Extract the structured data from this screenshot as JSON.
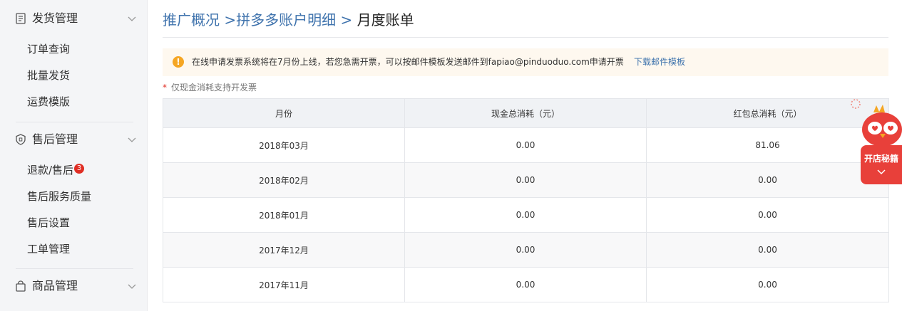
{
  "sidebar": {
    "sections": [
      {
        "title": "发货管理",
        "icon": "document-icon",
        "items": [
          "订单查询",
          "批量发货",
          "运费模版"
        ]
      },
      {
        "title": "售后管理",
        "icon": "shield-icon",
        "items": [
          "退款/售后",
          "售后服务质量",
          "售后设置",
          "工单管理"
        ],
        "badge": "3"
      },
      {
        "title": "商品管理",
        "icon": "bag-icon",
        "items": []
      }
    ]
  },
  "breadcrumb": {
    "link1": "推广概况",
    "sep1": " >",
    "link2": "拼多多账户明细",
    "sep2": " > ",
    "current": "月度账单"
  },
  "notice": {
    "icon": "!",
    "text": "在线申请发票系统将在7月份上线，若您急需开票，可以按邮件模板发送邮件到fapiao@pinduoduo.com申请开票",
    "link": "下载邮件模板"
  },
  "note": {
    "star": "*",
    "text": "仅现金消耗支持开发票"
  },
  "table": {
    "headers": [
      "月份",
      "现金总消耗（元）",
      "红包总消耗（元）"
    ],
    "rows": [
      [
        "2018年03月",
        "0.00",
        "81.06"
      ],
      [
        "2018年02月",
        "0.00",
        "0.00"
      ],
      [
        "2018年01月",
        "0.00",
        "0.00"
      ],
      [
        "2017年12月",
        "0.00",
        "0.00"
      ],
      [
        "2017年11月",
        "0.00",
        "0.00"
      ]
    ]
  },
  "widget": {
    "label": "开店秘籍"
  },
  "colors": {
    "link": "#3f73ad",
    "badge": "#e02e24",
    "warning": "#f5a623",
    "widget": "#e8403a"
  }
}
